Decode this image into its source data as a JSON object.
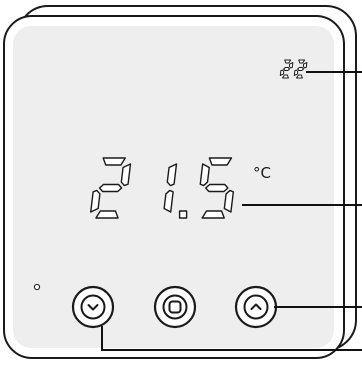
{
  "thermostat": {
    "setpoint": "22",
    "temperature": "21.5",
    "unit": "°C"
  },
  "buttons": [
    {
      "name": "down",
      "icon": "chevron-down-icon"
    },
    {
      "name": "mode",
      "icon": "square-icon"
    },
    {
      "name": "up",
      "icon": "chevron-up-icon"
    }
  ],
  "colors": {
    "device_body": "#ffffff",
    "screen": "#eeeeee",
    "outline": "#1a1a1a"
  }
}
